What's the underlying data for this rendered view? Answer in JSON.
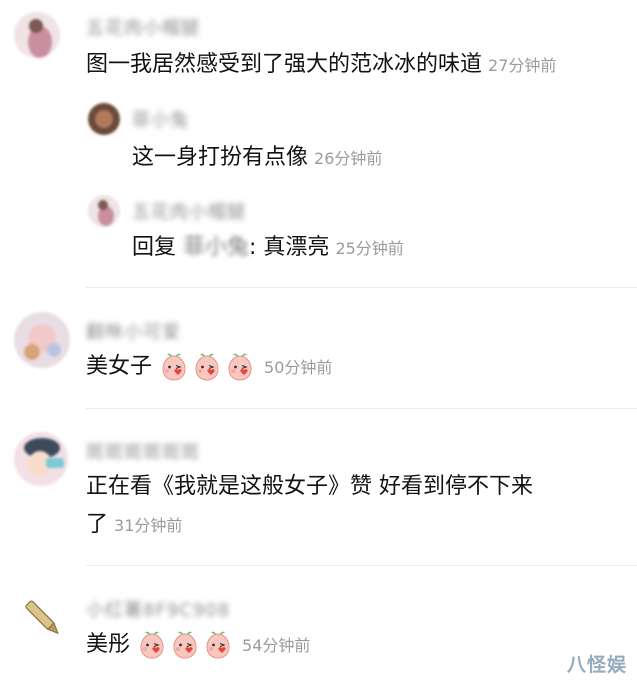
{
  "comments": [
    {
      "name": "五花肉小帽腿",
      "text": "图一我居然感受到了强大的范冰冰的味道",
      "time": "27分钟前",
      "replies": [
        {
          "name": "菲小兔",
          "text": "这一身打扮有点像",
          "time": "26分钟前"
        },
        {
          "name": "五花肉小帽腿",
          "reply_prefix": "回复",
          "reply_to": "菲小兔",
          "text": ": 真漂亮",
          "time": "25分钟前"
        }
      ]
    },
    {
      "name": "翻咻小可爱",
      "text": "美女子",
      "time": "50分钟前",
      "emoji_count": 3
    },
    {
      "name": "斑斑斑斑斑斑",
      "text_line1": "正在看《我就是这般女子》赞   好看到停不下来",
      "text_line2": "了",
      "time": "31分钟前"
    },
    {
      "name": "小红薯8F9C908",
      "text": "美彤",
      "time": "54分钟前",
      "emoji_count": 3
    }
  ],
  "watermark": "八怪娱",
  "colors": {
    "name": "#9a9a9a",
    "time": "#9b9b9b",
    "text": "#121212",
    "divider": "#ececec"
  }
}
